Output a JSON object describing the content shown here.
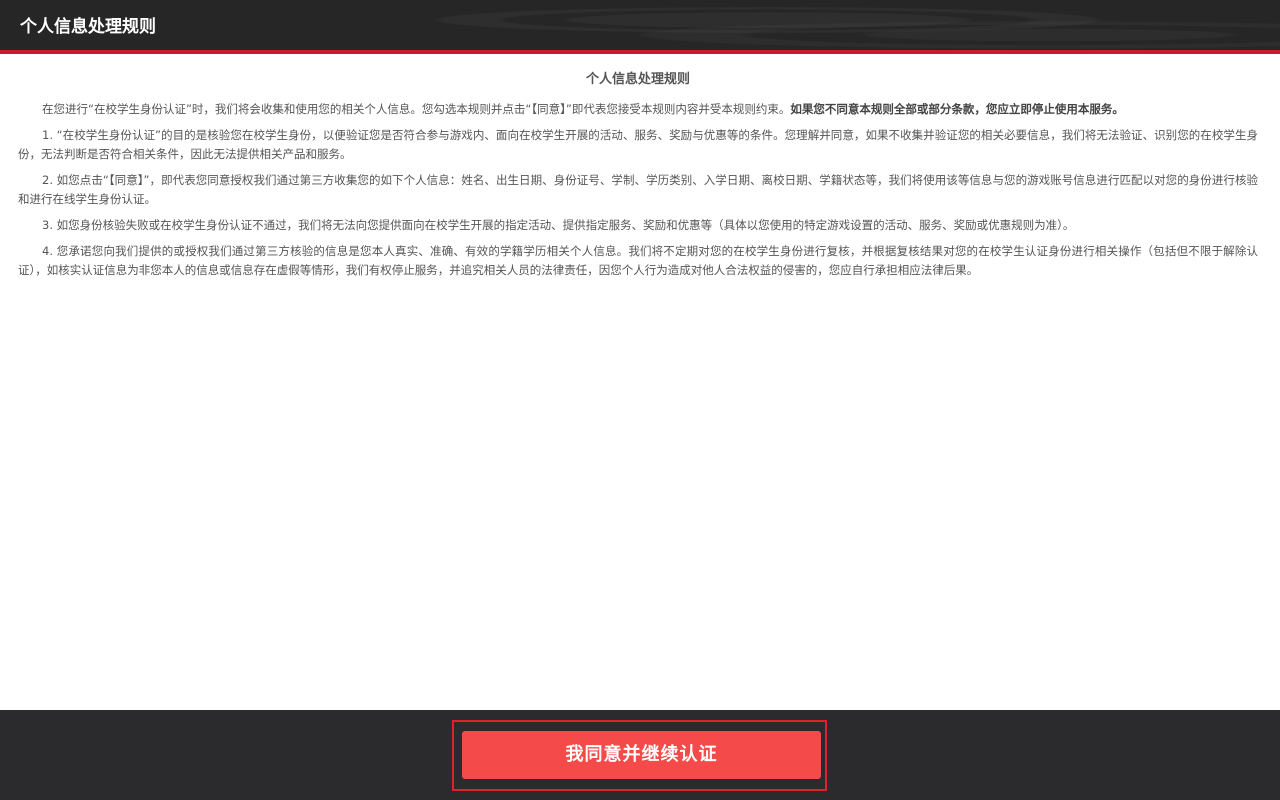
{
  "header": {
    "title": "个人信息处理规则"
  },
  "document": {
    "title": "个人信息处理规则",
    "paragraphs": [
      {
        "text": "在您进行“在校学生身份认证”时，我们将会收集和使用您的相关个人信息。您勾选本规则并点击“【同意】”即代表您接受本规则内容并受本规则约束。",
        "strong": "如果您不同意本规则全部或部分条款，您应立即停止使用本服务。"
      },
      {
        "text": "1. “在校学生身份认证”的目的是核验您在校学生身份，以便验证您是否符合参与游戏内、面向在校学生开展的活动、服务、奖励与优惠等的条件。您理解并同意，如果不收集并验证您的相关必要信息，我们将无法验证、识别您的在校学生身份，无法判断是否符合相关条件，因此无法提供相关产品和服务。"
      },
      {
        "text": "2. 如您点击“【同意】”，即代表您同意授权我们通过第三方收集您的如下个人信息：姓名、出生日期、身份证号、学制、学历类别、入学日期、离校日期、学籍状态等，我们将使用该等信息与您的游戏账号信息进行匹配以对您的身份进行核验和进行在线学生身份认证。"
      },
      {
        "text": "3. 如您身份核验失败或在校学生身份认证不通过，我们将无法向您提供面向在校学生开展的指定活动、提供指定服务、奖励和优惠等（具体以您使用的特定游戏设置的活动、服务、奖励或优惠规则为准）。"
      },
      {
        "text": "4. 您承诺您向我们提供的或授权我们通过第三方核验的信息是您本人真实、准确、有效的学籍学历相关个人信息。我们将不定期对您的在校学生身份进行复核，并根据复核结果对您的在校学生认证身份进行相关操作（包括但不限于解除认证），如核实认证信息为非您本人的信息或信息存在虚假等情形，我们有权停止服务，并追究相关人员的法律责任，因您个人行为造成对他人合法权益的侵害的，您应自行承担相应法律后果。"
      }
    ]
  },
  "footer": {
    "agree_label": "我同意并继续认证"
  },
  "colors": {
    "header_bg": "#262626",
    "header_accent": "#c81d2c",
    "body_text": "#555555",
    "footer_bg": "#2b2b2d",
    "button_bg": "#f44a4a",
    "button_frame": "#e0202d"
  }
}
